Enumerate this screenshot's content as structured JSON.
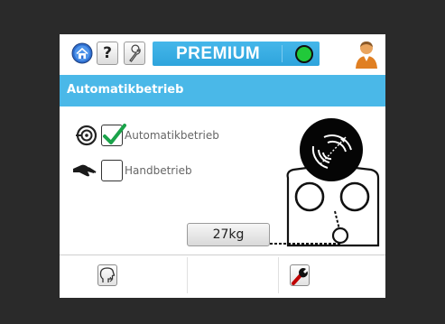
{
  "header": {
    "brand_label": "PREMIUM",
    "status_color": "#21c93a",
    "icons": [
      "home-icon",
      "help-icon",
      "wrench-icon",
      "status-led",
      "user-avatar"
    ],
    "help_label": "?"
  },
  "title": "Automatikbetrieb",
  "modes": {
    "auto": {
      "label": "Automatikbetrieb",
      "checked": true
    },
    "hand": {
      "label": "Handbetrieb",
      "checked": false
    }
  },
  "weight": "27kg",
  "footer": {
    "icons": [
      "speech-head-icon",
      "wrench-icon"
    ]
  },
  "colors": {
    "accent": "#4ab8e8",
    "check": "#1aa34a"
  }
}
